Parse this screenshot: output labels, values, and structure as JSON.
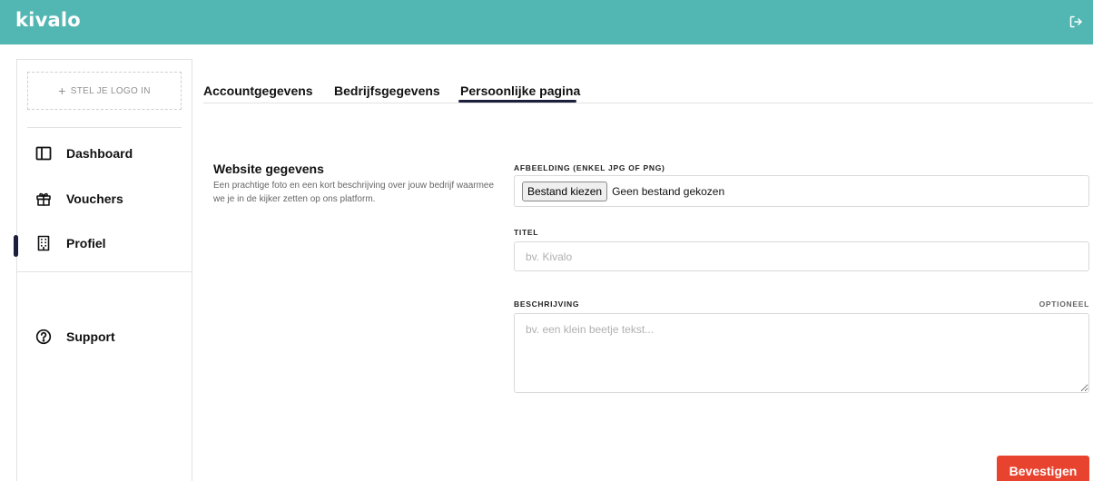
{
  "header": {
    "brand": "kivalo",
    "logout_icon": "logout-icon",
    "color": "#52b7b2"
  },
  "sidebar": {
    "logo_upload": {
      "plus": "+",
      "label": "STEL JE LOGO IN"
    },
    "items": [
      {
        "label": "Dashboard",
        "icon": "dashboard-icon",
        "active": false
      },
      {
        "label": "Vouchers",
        "icon": "gift-icon",
        "active": false
      },
      {
        "label": "Profiel",
        "icon": "building-icon",
        "active": true
      },
      {
        "label": "Support",
        "icon": "help-icon",
        "active": false
      }
    ],
    "active_color": "#1b1f3b"
  },
  "tabs": [
    {
      "label": "Accountgegevens",
      "active": false
    },
    {
      "label": "Bedrijfsgegevens",
      "active": false
    },
    {
      "label": "Persoonlijke pagina",
      "active": true
    }
  ],
  "section": {
    "title": "Website gegevens",
    "description": "Een prachtige foto en een kort beschrijving over jouw bedrijf waarmee we je in de kijker zetten op ons platform."
  },
  "form": {
    "image": {
      "label": "AFBEELDING (ENKEL JPG OF PNG)",
      "button": "Bestand kiezen",
      "status": "Geen bestand gekozen"
    },
    "title": {
      "label": "TITEL",
      "placeholder": "bv. Kivalo",
      "value": ""
    },
    "description": {
      "label": "BESCHRIJVING",
      "optional": "OPTIONEEL",
      "placeholder": "bv. een klein beetje tekst...",
      "value": ""
    },
    "submit": "Bevestigen",
    "submit_color": "#e8432e"
  }
}
